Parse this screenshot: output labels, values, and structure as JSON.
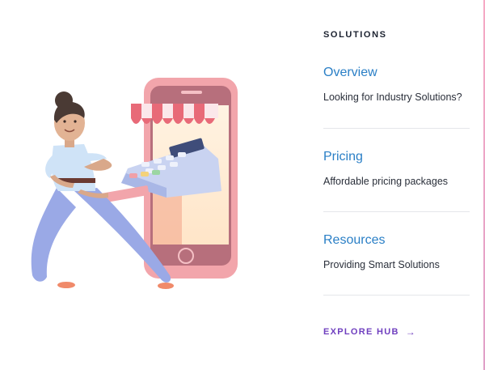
{
  "section": {
    "heading": "SOLUTIONS"
  },
  "menu": {
    "items": [
      {
        "title": "Overview",
        "description": "Looking for Industry Solutions?"
      },
      {
        "title": "Pricing",
        "description": "Affordable pricing packages"
      },
      {
        "title": "Resources",
        "description": "Providing Smart Solutions"
      }
    ]
  },
  "cta": {
    "label": "EXPLORE HUB",
    "icon": "arrow-right-icon",
    "arrow_glyph": "→"
  },
  "illustration": {
    "description": "woman-with-phone-payment-terminal",
    "colors": {
      "phone": "#f2a5ab",
      "awning": "#e86a78",
      "terminal": "#c9d3f1",
      "shirt": "#cfe3f7",
      "pants": "#9aa9e6"
    }
  },
  "colors": {
    "accent_link": "#2a7fc6",
    "cta": "#6f3fbf",
    "divider": "#e5e6ea",
    "edge": "#f6a9c4"
  }
}
